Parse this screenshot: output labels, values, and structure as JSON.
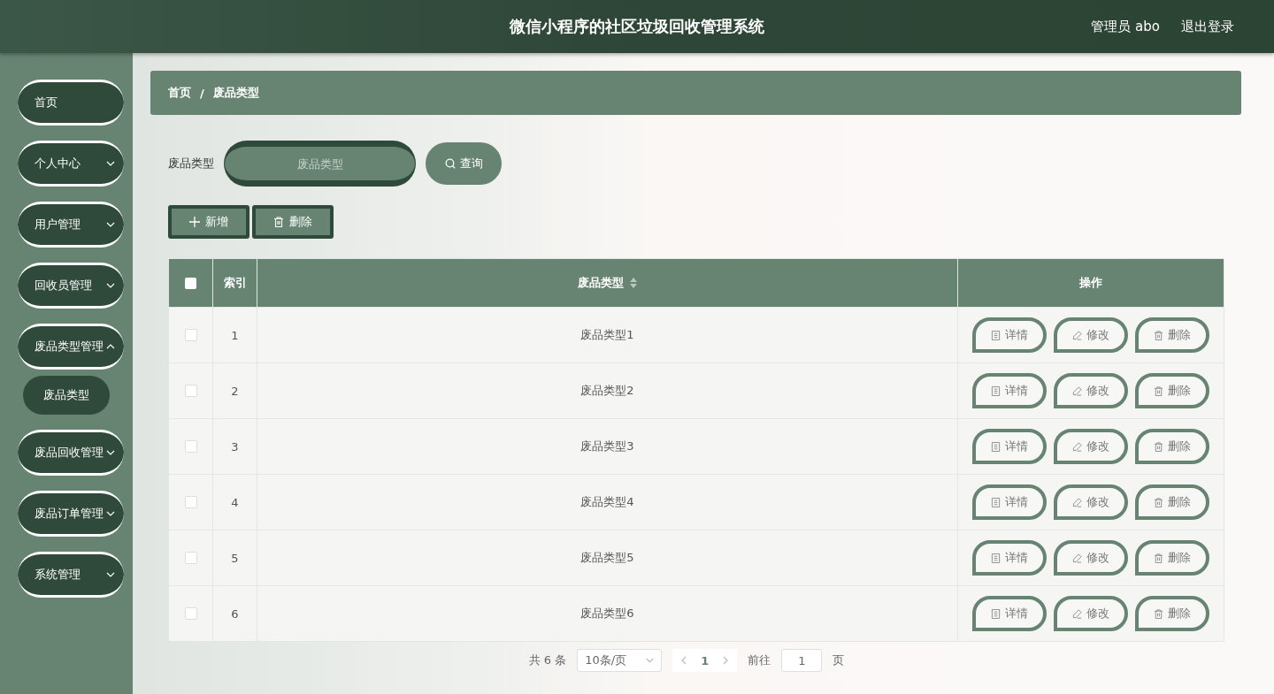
{
  "header": {
    "title": "微信小程序的社区垃圾回收管理系统",
    "user": "管理员 abo",
    "logout": "退出登录"
  },
  "sidebar": {
    "items": [
      {
        "label": "首页",
        "kind": "link"
      },
      {
        "label": "个人中心",
        "kind": "submenu",
        "expanded": false
      },
      {
        "label": "用户管理",
        "kind": "submenu",
        "expanded": false
      },
      {
        "label": "回收员管理",
        "kind": "submenu",
        "expanded": false
      },
      {
        "label": "废品类型管理",
        "kind": "submenu",
        "expanded": true,
        "children": [
          {
            "label": "废品类型",
            "selected": true
          }
        ]
      },
      {
        "label": "废品回收管理",
        "kind": "submenu",
        "expanded": false
      },
      {
        "label": "废品订单管理",
        "kind": "submenu",
        "expanded": false
      },
      {
        "label": "系统管理",
        "kind": "submenu",
        "expanded": false
      }
    ]
  },
  "breadcrumb": [
    "首页",
    "/",
    "废品类型"
  ],
  "search": {
    "label": "废品类型",
    "placeholder": "废品类型",
    "button": "查询"
  },
  "actions": [
    "新增",
    "删除"
  ],
  "table": {
    "header_checked": false,
    "columns": [
      "索引",
      "废品类型",
      "操作"
    ],
    "rows": [
      {
        "checked": false,
        "index": "1",
        "name": "废品类型1",
        "buttons": [
          "详情",
          "修改",
          "删除"
        ]
      },
      {
        "checked": false,
        "index": "2",
        "name": "废品类型2",
        "buttons": [
          "详情",
          "修改",
          "删除"
        ]
      },
      {
        "checked": false,
        "index": "3",
        "name": "废品类型3",
        "buttons": [
          "详情",
          "修改",
          "删除"
        ]
      },
      {
        "checked": false,
        "index": "4",
        "name": "废品类型4",
        "buttons": [
          "详情",
          "修改",
          "删除"
        ]
      },
      {
        "checked": false,
        "index": "5",
        "name": "废品类型5",
        "buttons": [
          "详情",
          "修改",
          "删除"
        ]
      },
      {
        "checked": false,
        "index": "6",
        "name": "废品类型6",
        "buttons": [
          "详情",
          "修改",
          "删除"
        ]
      }
    ]
  },
  "pagination": {
    "total": "共 6 条",
    "page_size": "10条/页",
    "pages": [
      {
        "label": "1",
        "selected": true
      }
    ],
    "goto": "前往",
    "goto_value": "1",
    "goto_unit": "页"
  }
}
